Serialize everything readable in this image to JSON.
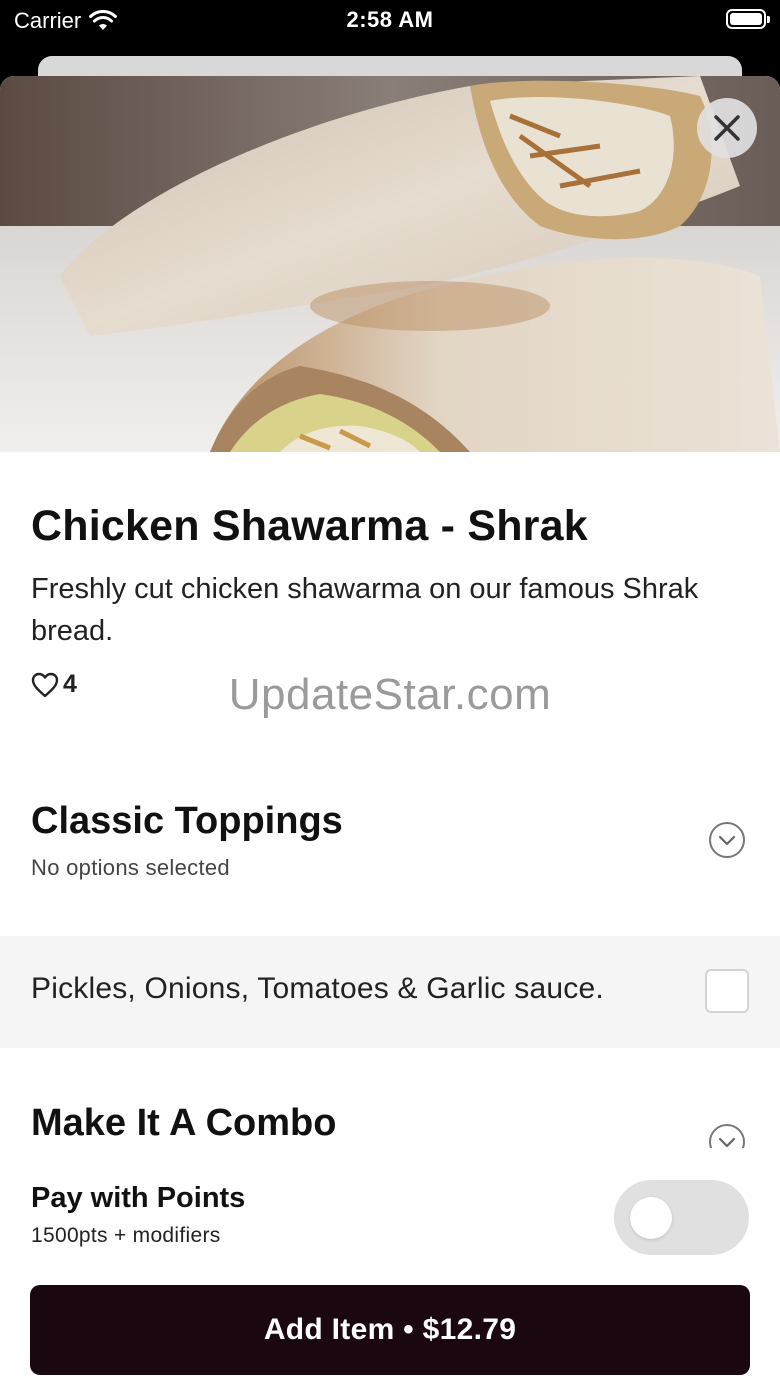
{
  "status_bar": {
    "carrier": "Carrier",
    "time": "2:58 AM"
  },
  "item": {
    "image_icon": "shawarma-wrap-photo",
    "title": "Chicken Shawarma - Shrak",
    "description": "Freshly cut chicken shawarma on our famous Shrak bread.",
    "likes": "4"
  },
  "watermark": "UpdateStar.com",
  "sections": [
    {
      "title": "Classic Toppings",
      "subtitle": "No options selected",
      "options": [
        {
          "label": "Pickles, Onions, Tomatoes & Garlic sauce.",
          "checked": false
        }
      ]
    },
    {
      "title": "Make It A Combo"
    }
  ],
  "points": {
    "title": "Pay with Points",
    "subtitle": "1500pts + modifiers",
    "enabled": false
  },
  "add_button": {
    "label": "Add Item • $12.79"
  },
  "colors": {
    "button_bg": "#1a0710",
    "option_row_bg": "#f5f5f5",
    "toggle_off": "#e0e0e0"
  }
}
